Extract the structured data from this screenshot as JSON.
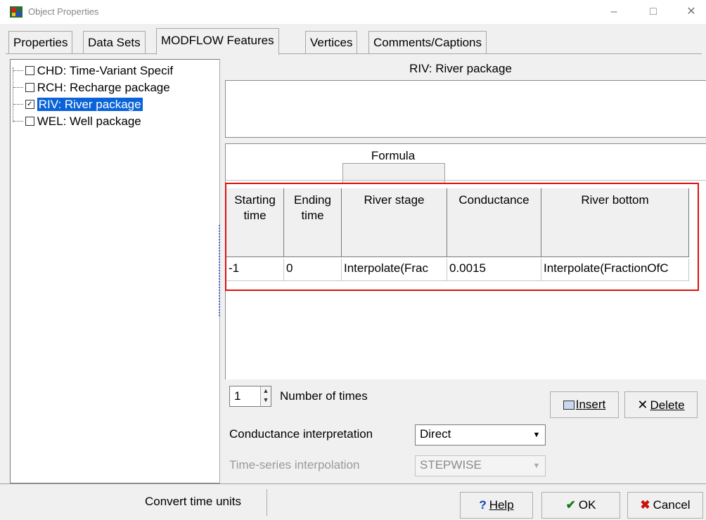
{
  "window": {
    "title": "Object Properties"
  },
  "tabs": [
    {
      "label": "Properties",
      "active": false
    },
    {
      "label": "Data Sets",
      "active": false
    },
    {
      "label": "MODFLOW Features",
      "active": true
    },
    {
      "label": "Vertices",
      "active": false
    },
    {
      "label": "Comments/Captions",
      "active": false
    }
  ],
  "tree": {
    "items": [
      {
        "label": "CHD: Time-Variant Specif",
        "checked": false,
        "selected": false
      },
      {
        "label": "RCH: Recharge package",
        "checked": false,
        "selected": false
      },
      {
        "label": "RIV: River package",
        "checked": true,
        "selected": true
      },
      {
        "label": "WEL: Well package",
        "checked": false,
        "selected": false
      }
    ]
  },
  "package": {
    "title": "RIV: River package"
  },
  "formula_label": "Formula",
  "grid": {
    "headers": [
      "Starting time",
      "Ending time",
      "River stage",
      "Conductance",
      "River bottom"
    ],
    "rows": [
      [
        "-1",
        "0",
        "Interpolate(Frac",
        "0.0015",
        "Interpolate(FractionOfC"
      ]
    ]
  },
  "controls": {
    "number_of_times_value": "1",
    "number_of_times_label": "Number of times",
    "insert_label": "Insert",
    "delete_label": "Delete",
    "conductance_label": "Conductance interpretation",
    "conductance_value": "Direct",
    "timeseries_label": "Time-series interpolation",
    "timeseries_value": "STEPWISE"
  },
  "footer": {
    "convert_label": "Convert time units",
    "help_label": "Help",
    "ok_label": "OK",
    "cancel_label": "Cancel"
  },
  "colors": {
    "selection": "#0a63d8",
    "highlight_box": "#e01010",
    "ok_check": "#1a7a1a",
    "cancel_x": "#c81010",
    "help_q": "#1040c0"
  }
}
